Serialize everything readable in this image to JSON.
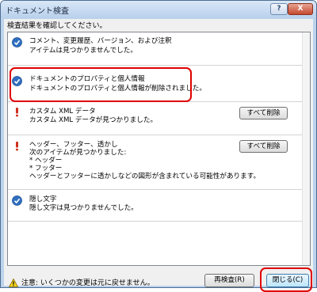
{
  "window": {
    "title": "ドキュメント検査",
    "help_label": "?",
    "close_label": "X"
  },
  "prompt": "検査結果を確認してください。",
  "results": [
    {
      "status": "ok",
      "icon": "check-circle-icon",
      "title": "コメント、変更履歴、バージョン、および注釈",
      "detail": "アイテムは見つかりませんでした。"
    },
    {
      "status": "ok",
      "icon": "check-circle-icon",
      "title": "ドキュメントのプロパティと個人情報",
      "detail": "ドキュメントのプロパティと個人情報が削除されました。"
    },
    {
      "status": "found",
      "icon": "exclamation-icon",
      "title": "カスタム XML データ",
      "detail": "カスタム XML データが見つかりました。",
      "button": "すべて削除"
    },
    {
      "status": "found",
      "icon": "exclamation-icon",
      "title": "ヘッダー、フッター、透かし",
      "detail_lines": [
        "次のアイテムが見つかりました:",
        "* ヘッダー",
        "* フッター",
        "ヘッダーとフッターに透かしなどの図形が含まれている可能性があります。"
      ],
      "button": "すべて削除"
    },
    {
      "status": "ok",
      "icon": "check-circle-icon",
      "title": "隠し文字",
      "detail": "隠し文字は見つかりませんでした。"
    }
  ],
  "footer": {
    "warning_icon": "warning-triangle-icon",
    "warning": "注意: いくつかの変更は元に戻せません。",
    "recheck_label": "再検査(R)",
    "close_label": "閉じる(C)"
  },
  "colors": {
    "highlight": "#e00000",
    "check_icon": "#2f6fc0",
    "exclaim_icon": "#d03020"
  }
}
